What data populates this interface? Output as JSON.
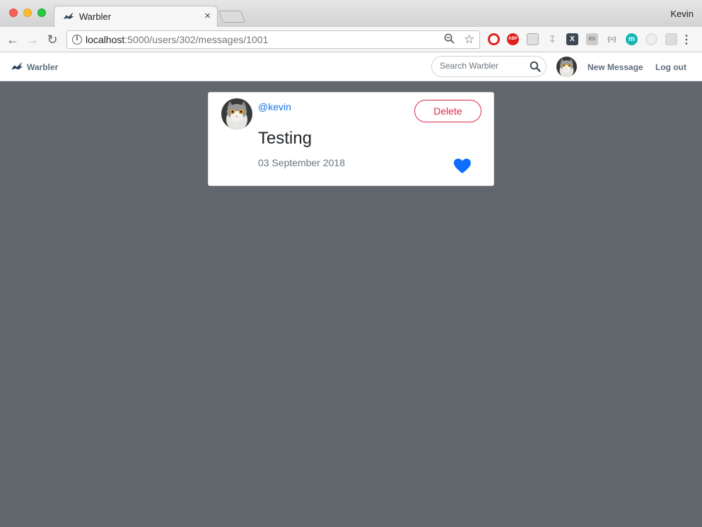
{
  "browser": {
    "tab_title": "Warbler",
    "tab_close": "×",
    "profile_name": "Kevin",
    "url_host": "localhost",
    "url_rest": ":5000/users/302/messages/1001",
    "extensions": [
      "opera-icon",
      "adblock-icon",
      "cube-icon",
      "download-icon",
      "x-icon",
      "es-icon",
      "json-icon",
      "m-icon",
      "circle-icon",
      "puzzle-icon"
    ]
  },
  "navbar": {
    "brand": "Warbler",
    "search_placeholder": "Search Warbler",
    "new_message": "New Message",
    "log_out": "Log out"
  },
  "message": {
    "username": "@kevin",
    "delete_label": "Delete",
    "text": "Testing",
    "date": "03 September 2018",
    "liked": true
  },
  "colors": {
    "background": "#62666d",
    "like": "#0d6efd",
    "delete": "#dc2a4f",
    "username": "#1a73e8"
  }
}
